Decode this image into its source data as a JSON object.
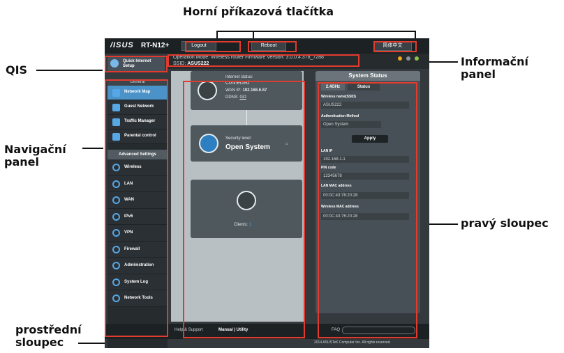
{
  "callouts": {
    "top_buttons": "Horní příkazová tlačítka",
    "qis": "QIS",
    "info_panel_1": "Informační",
    "info_panel_2": "panel",
    "nav_panel_1": "Navigační",
    "nav_panel_2": "panel",
    "right_col": "pravý sloupec",
    "mid_col_1": "prostřední",
    "mid_col_2": "sloupec"
  },
  "router": {
    "logo": "/ISUS",
    "model": "RT-N12+",
    "buttons": {
      "logout": "Logout",
      "reboot": "Reboot",
      "language": "简体中文"
    },
    "info": {
      "line1": "Operation Mode: Wireless router  Firmware Version: 3.0.0.4.378_7288",
      "ssid_label": "SSID:",
      "ssid": "ASUS222"
    },
    "qis": {
      "line1": "Quick Internet",
      "line2": "Setup"
    },
    "nav": {
      "general": "General",
      "items": [
        "Network Map",
        "Guest Network",
        "Traffic Manager",
        "Parental control"
      ],
      "advanced_header": "Advanced Settings",
      "advanced": [
        "Wireless",
        "LAN",
        "WAN",
        "IPv6",
        "VPN",
        "Firewall",
        "Administration",
        "System Log",
        "Network Tools"
      ]
    },
    "map": {
      "internet_status": "Internet status:",
      "connected": "Connected",
      "wan_ip_label": "WAN IP:",
      "wan_ip": "192.168.6.67",
      "ddns_label": "DDNS:",
      "ddns": "GO",
      "security_label": "Security level:",
      "security": "Open System",
      "clients_label": "Clients:",
      "clients": "1"
    },
    "status": {
      "title": "System Status",
      "tab1": "2.4GHz",
      "tab2": "Status",
      "ssid_label": "Wireless name(SSID)",
      "ssid_value": "ASUS222",
      "auth_label": "Authentication Method",
      "auth_value": "Open System",
      "apply": "Apply",
      "lan_ip_label": "LAN IP",
      "lan_ip": "192.168.1.1",
      "pin_label": "PIN code",
      "pin": "12345678",
      "lan_mac_label": "LAN MAC address",
      "lan_mac": "00:0C:43:76:20:28",
      "wl_mac_label": "Wireless MAC address",
      "wl_mac": "00:0C:43:76:20:28"
    },
    "footer": {
      "help": "Help & Support",
      "manual": "Manual | Utility",
      "faq": "FAQ",
      "copyright": "2014 ASUSTeK Computer Inc. All rights reserved."
    }
  },
  "colors": {
    "highlight": "#e23b2e",
    "accent": "#4a92c8"
  }
}
